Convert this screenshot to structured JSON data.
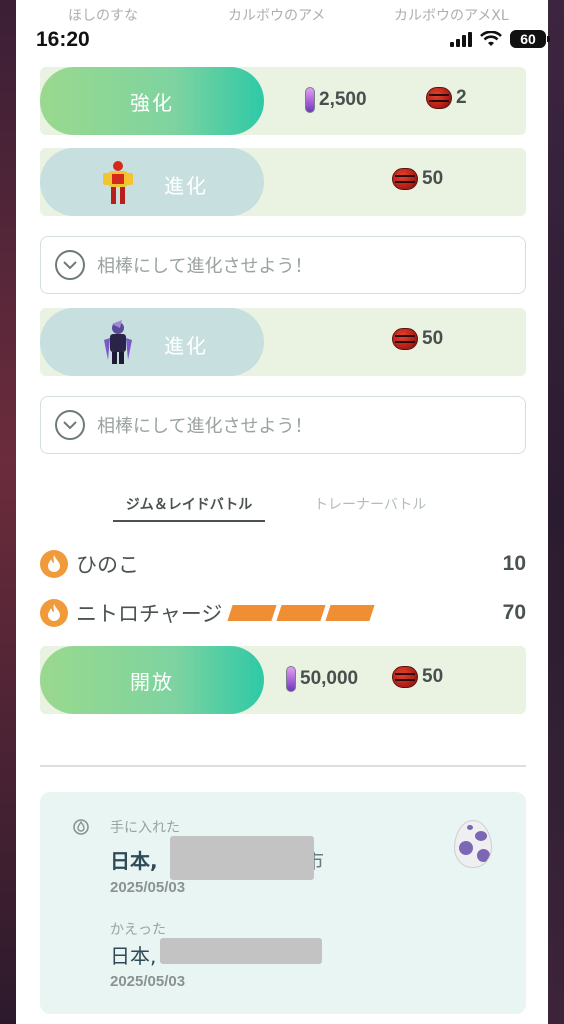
{
  "status_bar": {
    "time": "16:20",
    "battery": "60"
  },
  "header_labels": [
    "ほしのすな",
    "カルボウのアメ",
    "カルボウのアメXL"
  ],
  "power_up": {
    "label": "強化",
    "dust": "2,500",
    "candy": "2"
  },
  "evolutions": [
    {
      "label": "進化",
      "candy": "50",
      "buddy_text": "相棒にして進化させよう！"
    },
    {
      "label": "進化",
      "candy": "50",
      "buddy_text": "相棒にして進化させよう！"
    }
  ],
  "tabs": [
    {
      "label": "ジム＆レイドバトル"
    },
    {
      "label": "トレーナーバトル"
    }
  ],
  "moves": [
    {
      "name": "ひのこ",
      "power": "10"
    },
    {
      "name": "ニトロチャージ",
      "power": "70"
    }
  ],
  "unlock": {
    "label": "開放",
    "dust": "50,000",
    "candy": "50"
  },
  "info_card": {
    "caught_label": "手に入れた",
    "caught_place": "日本,",
    "caught_place_tail": "市",
    "caught_date": "2025/05/03",
    "hatched_label": "かえった",
    "hatched_place": "日本,",
    "hatched_date": "2025/05/03"
  },
  "colors": {
    "accent_green": "#2ec9a6",
    "fire": "#f09a3a",
    "candy_red": "#b31f16"
  }
}
